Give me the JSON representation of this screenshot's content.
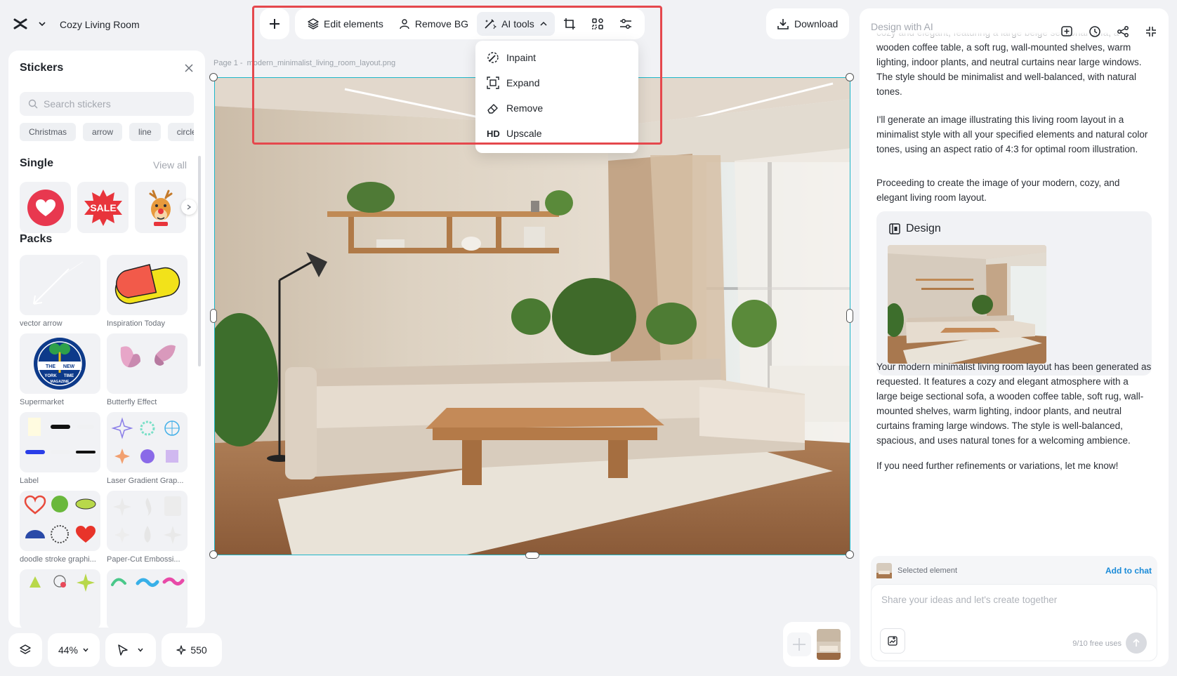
{
  "project": {
    "title": "Cozy Living Room"
  },
  "toolbar": {
    "edit_elements": "Edit elements",
    "remove_bg": "Remove BG",
    "ai_tools": "AI tools",
    "download": "Download"
  },
  "ai_menu": {
    "items": [
      {
        "label": "Inpaint",
        "icon": "inpaint-icon"
      },
      {
        "label": "Expand",
        "icon": "expand-icon"
      },
      {
        "label": "Remove",
        "icon": "eraser-icon"
      },
      {
        "label": "Upscale",
        "icon": "hd-icon",
        "glyph": "HD"
      }
    ]
  },
  "stickers": {
    "title": "Stickers",
    "search_placeholder": "Search stickers",
    "tags": [
      "Christmas",
      "arrow",
      "line",
      "circle"
    ],
    "single_title": "Single",
    "view_all": "View all",
    "sale_text": "SALE",
    "packs_title": "Packs",
    "packs": [
      "vector arrow",
      "Inspiration Today",
      "Supermarket",
      "Butterfly Effect",
      "Label",
      "Laser Gradient Grap...",
      "doodle stroke graphi...",
      "Paper-Cut Embossi..."
    ],
    "magazine_text": [
      "THE",
      "NEW",
      "YORK",
      "TIME",
      "MAGAZINE"
    ]
  },
  "canvas": {
    "page_label": "Page 1 -",
    "file_name": "modern_minimalist_living_room_layout.png"
  },
  "bottom_bar": {
    "zoom": "44%",
    "credits": "550"
  },
  "right_panel": {
    "title": "Design with AI",
    "para0": "cozy and elegant, featuring a large beige sectional sofa, a wooden coffee table, a soft rug, wall-mounted shelves, warm lighting, indoor plants, and neutral curtains near large windows. The style should be minimalist and well-balanced, with natural tones.",
    "para1": "I'll generate an image illustrating this living room layout in a minimalist style with all your specified elements and natural color tones, using an aspect ratio of 4:3 for optimal room illustration.",
    "para2": "Proceeding to create the image of your modern, cozy, and elegant living room layout.",
    "design_title": "Design",
    "para3": "Your modern minimalist living room layout has been generated as requested. It features a cozy and elegant atmosphere with a large beige sectional sofa, a wooden coffee table, soft rug, wall-mounted shelves, warm lighting, indoor plants, and neutral curtains framing large windows. The style is well-balanced, spacious, and uses natural tones for a welcoming ambience.",
    "para4": "If you need further refinements or variations, let me know!",
    "selected_element": "Selected element",
    "add_to_chat": "Add to chat",
    "input_placeholder": "Share your ideas and let's create together",
    "free_uses": "9/10 free uses"
  },
  "colors": {
    "highlight": "#e5484d",
    "selection": "#1fb7c9",
    "link": "#1a8bd8"
  }
}
